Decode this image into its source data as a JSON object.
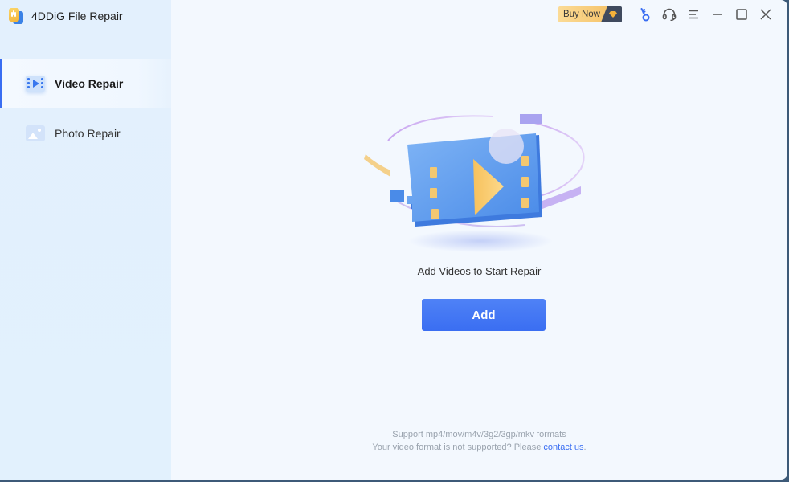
{
  "app": {
    "title": "4DDiG File Repair",
    "accent_color": "#3a6ef2"
  },
  "sidebar": {
    "items": [
      {
        "label": "Video Repair",
        "icon": "video-icon",
        "active": true
      },
      {
        "label": "Photo Repair",
        "icon": "photo-icon",
        "active": false
      }
    ]
  },
  "topbar": {
    "buy_now_label": "Buy Now",
    "icons": [
      "key-icon",
      "headset-icon",
      "menu-icon",
      "minimize-icon",
      "maximize-icon",
      "close-icon"
    ]
  },
  "main": {
    "illustration": "video-file-illustration",
    "prompt": "Add Videos to Start Repair",
    "add_button_label": "Add",
    "support_formats": "Support mp4/mov/m4v/3g2/3gp/mkv formats",
    "unsupported_prefix": "Your video format is not supported? Please ",
    "contact_link": "contact us",
    "unsupported_suffix": "."
  }
}
